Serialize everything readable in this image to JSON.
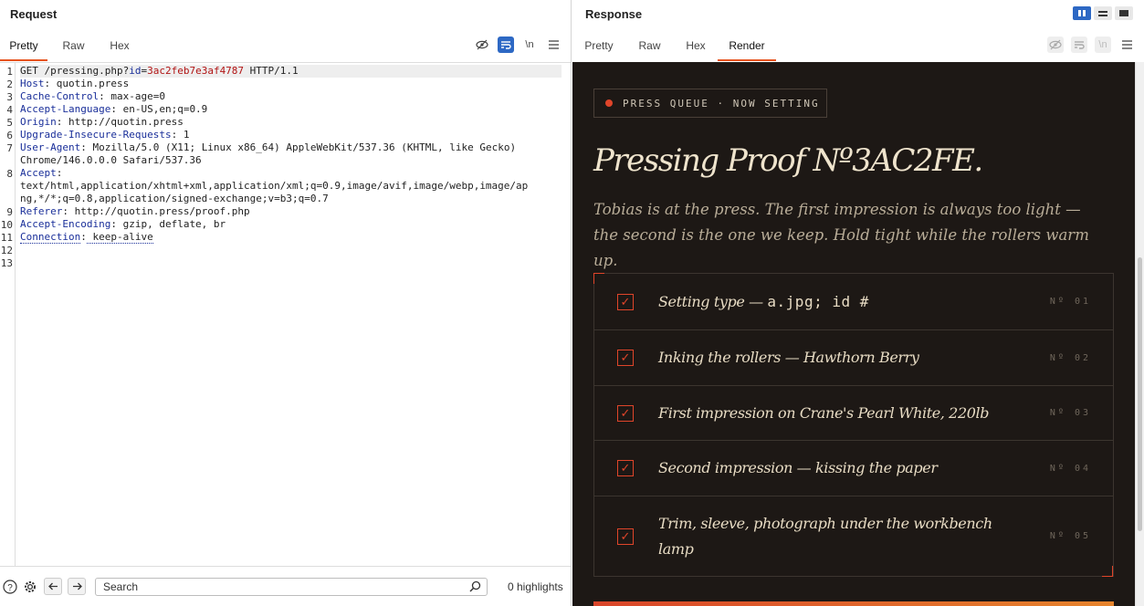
{
  "request": {
    "title": "Request",
    "tabs": [
      {
        "label": "Pretty",
        "active": true
      },
      {
        "label": "Raw",
        "active": false
      },
      {
        "label": "Hex",
        "active": false
      }
    ],
    "toolbar": {
      "newline_label": "\\n"
    },
    "lines": [
      {
        "num": "1",
        "text": ""
      },
      {
        "num": "2",
        "key": "Host",
        "value": " quotin.press"
      },
      {
        "num": "3",
        "key": "Cache-Control",
        "value": " max-age=0"
      },
      {
        "num": "4",
        "key": "Accept-Language",
        "value": " en-US,en;q=0.9"
      },
      {
        "num": "5",
        "key": "Origin",
        "value": " http://quotin.press"
      },
      {
        "num": "6",
        "key": "Upgrade-Insecure-Requests",
        "value": " 1"
      },
      {
        "num": "7",
        "key": "User-Agent",
        "value": " Mozilla/5.0 (X11; Linux x86_64) AppleWebKit/537.36 (KHTML, like Gecko)"
      },
      {
        "num": "",
        "text": "Chrome/146.0.0.0 Safari/537.36"
      },
      {
        "num": "8",
        "key": "Accept",
        "value": ""
      },
      {
        "num": "",
        "text": "text/html,application/xhtml+xml,application/xml;q=0.9,image/avif,image/webp,image/ap"
      },
      {
        "num": "",
        "text": "ng,*/*;q=0.8,application/signed-exchange;v=b3;q=0.7"
      },
      {
        "num": "9",
        "key": "Referer",
        "value": " http://quotin.press/proof.php"
      },
      {
        "num": "10",
        "key": "Accept-Encoding",
        "value": " gzip, deflate, br"
      },
      {
        "num": "11",
        "key": "Connection",
        "value": " keep-alive"
      },
      {
        "num": "12",
        "text": ""
      },
      {
        "num": "13",
        "text": ""
      }
    ],
    "first_line": {
      "method_path": "GET /pressing.php?",
      "param_key": "id",
      "eq": "=",
      "param_value": "3ac2feb7e3af4787",
      "protocol": " HTTP/1.1"
    },
    "bottom": {
      "search_placeholder": "Search",
      "highlights": "0 highlights"
    }
  },
  "response": {
    "title": "Response",
    "tabs": [
      {
        "label": "Pretty",
        "active": false
      },
      {
        "label": "Raw",
        "active": false
      },
      {
        "label": "Hex",
        "active": false
      },
      {
        "label": "Render",
        "active": true
      }
    ],
    "toolbar": {
      "newline_label": "\\n"
    },
    "render": {
      "queue_badge": "PRESS QUEUE · NOW SETTING",
      "title": "Pressing Proof Nº3AC2FE.",
      "subtitle": "Tobias is at the press. The first impression is always too light — the second is the one we keep. Hold tight while the rollers warm up.",
      "steps": [
        {
          "label_prefix": "Setting type — ",
          "label_mono": "a.jpg; id #",
          "label": "",
          "num": "Nº 01"
        },
        {
          "label_prefix": "",
          "label_mono": "",
          "label": "Inking the rollers — Hawthorn Berry",
          "num": "Nº 02"
        },
        {
          "label_prefix": "",
          "label_mono": "",
          "label": "First impression on Crane's Pearl White, 220lb",
          "num": "Nº 03"
        },
        {
          "label_prefix": "",
          "label_mono": "",
          "label": "Second impression — kissing the paper",
          "num": "Nº 04"
        },
        {
          "label_prefix": "",
          "label_mono": "",
          "label": "Trim, sleeve, photograph under the workbench lamp",
          "num": "Nº 05"
        }
      ],
      "check_mark": "✓"
    }
  },
  "colors": {
    "accent": "#e6531d",
    "render_bg": "#1d1815",
    "render_accent": "#e0452a",
    "header_key": "#1a2f9a",
    "param_value": "#b11414"
  }
}
